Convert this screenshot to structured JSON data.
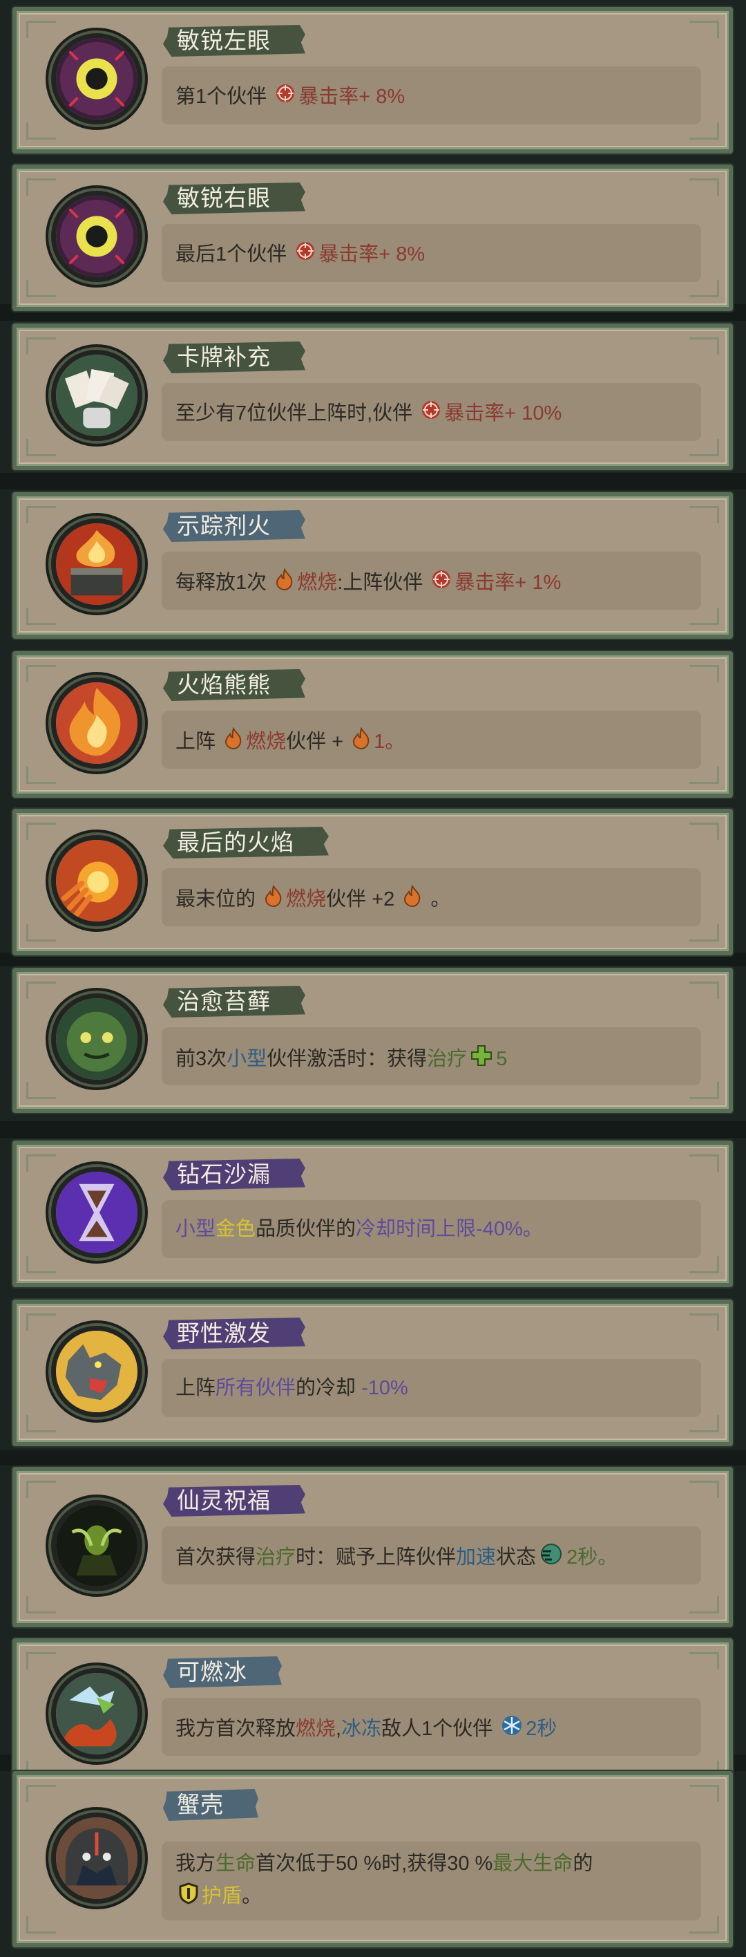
{
  "cards": [
    {
      "title": "敏锐左眼",
      "color": "green",
      "parts": [
        {
          "t": "第1个伙伴 "
        },
        {
          "icon": "crit-icon"
        },
        {
          "t": "暴击率",
          "c": "red"
        },
        {
          "t": "+ 8%",
          "c": "red"
        }
      ]
    },
    {
      "title": "敏锐右眼",
      "color": "green",
      "parts": [
        {
          "t": "最后1个伙伴 "
        },
        {
          "icon": "crit-icon"
        },
        {
          "t": "暴击率",
          "c": "red"
        },
        {
          "t": "+ 8%",
          "c": "red"
        }
      ]
    },
    {
      "title": "卡牌补充",
      "color": "green",
      "parts": [
        {
          "t": "至少有7位伙伴上阵时,伙伴 "
        },
        {
          "icon": "crit-icon"
        },
        {
          "t": "暴击率",
          "c": "red"
        },
        {
          "t": "+ 10%",
          "c": "red"
        }
      ]
    },
    {
      "title": "示踪剂火",
      "color": "blue",
      "parts": [
        {
          "t": "每释放1次 "
        },
        {
          "icon": "flame-icon"
        },
        {
          "t": "燃烧",
          "c": "red"
        },
        {
          "t": ":上阵伙伴 "
        },
        {
          "icon": "crit-icon"
        },
        {
          "t": "暴击率",
          "c": "red"
        },
        {
          "t": "+ 1%",
          "c": "red"
        }
      ]
    },
    {
      "title": "火焰熊熊",
      "color": "green",
      "parts": [
        {
          "t": "上阵 "
        },
        {
          "icon": "flame-icon"
        },
        {
          "t": "燃烧",
          "c": "red"
        },
        {
          "t": "伙伴 + "
        },
        {
          "icon": "flame-icon"
        },
        {
          "t": "1。",
          "c": "red"
        }
      ]
    },
    {
      "title": "最后的火焰",
      "color": "green",
      "parts": [
        {
          "t": "最末位的 "
        },
        {
          "icon": "flame-icon"
        },
        {
          "t": "燃烧",
          "c": "red"
        },
        {
          "t": "伙伴 +2 "
        },
        {
          "icon": "flame-icon"
        },
        {
          "t": " 。"
        }
      ]
    },
    {
      "title": "治愈苔藓",
      "color": "green",
      "parts": [
        {
          "t": "前3次"
        },
        {
          "t": "小型",
          "c": "blu"
        },
        {
          "t": "伙伴激活时：获得"
        },
        {
          "t": "治疗",
          "c": "grn"
        },
        {
          "icon": "heal-icon"
        },
        {
          "t": "5",
          "c": "grn"
        }
      ]
    },
    {
      "title": "钻石沙漏",
      "color": "purple",
      "parts": [
        {
          "t": "小型",
          "c": "pur"
        },
        {
          "t": "金色",
          "c": "gold"
        },
        {
          "t": "品质伙伴的"
        },
        {
          "t": "冷却时间上限",
          "c": "pur"
        },
        {
          "t": "-40%。",
          "c": "pur"
        }
      ]
    },
    {
      "title": "野性激发",
      "color": "purple",
      "parts": [
        {
          "t": "上阵"
        },
        {
          "t": "所有伙伴",
          "c": "pur"
        },
        {
          "t": "的冷却 "
        },
        {
          "t": "-10%",
          "c": "pur"
        }
      ]
    },
    {
      "title": "仙灵祝福",
      "color": "purple",
      "parts": [
        {
          "t": "首次获得"
        },
        {
          "t": "治疗",
          "c": "grn"
        },
        {
          "t": "时：赋予上阵伙伴"
        },
        {
          "t": "加速",
          "c": "blu"
        },
        {
          "t": "状态"
        },
        {
          "icon": "haste-icon"
        },
        {
          "t": "2秒。",
          "c": "grn"
        }
      ]
    },
    {
      "title": "可燃冰",
      "color": "blue",
      "parts": [
        {
          "t": "我方首次释放"
        },
        {
          "t": "燃烧",
          "c": "red"
        },
        {
          "t": ","
        },
        {
          "t": "冰冻",
          "c": "blu"
        },
        {
          "t": "敌人1个伙伴 "
        },
        {
          "icon": "snow-icon"
        },
        {
          "t": "2秒",
          "c": "blu"
        }
      ]
    },
    {
      "title": "蟹壳",
      "color": "blue",
      "parts": [
        {
          "t": "我方"
        },
        {
          "t": "生命",
          "c": "grn"
        },
        {
          "t": "首次低于50 %时,获得30 %"
        },
        {
          "t": "最大生命",
          "c": "grn"
        },
        {
          "t": "的"
        },
        {
          "br": true
        },
        {
          "icon": "shield-icon"
        },
        {
          "t": "护盾",
          "c": "gold"
        },
        {
          "t": "。"
        }
      ]
    }
  ],
  "badges": [
    "eye-icon",
    "eye-icon",
    "cards-icon",
    "fire-brazier-icon",
    "fire-icon",
    "fireball-icon",
    "moss-icon",
    "hourglass-icon",
    "wolf-icon",
    "fairy-icon",
    "ice-fire-icon",
    "crab-shell-icon"
  ]
}
